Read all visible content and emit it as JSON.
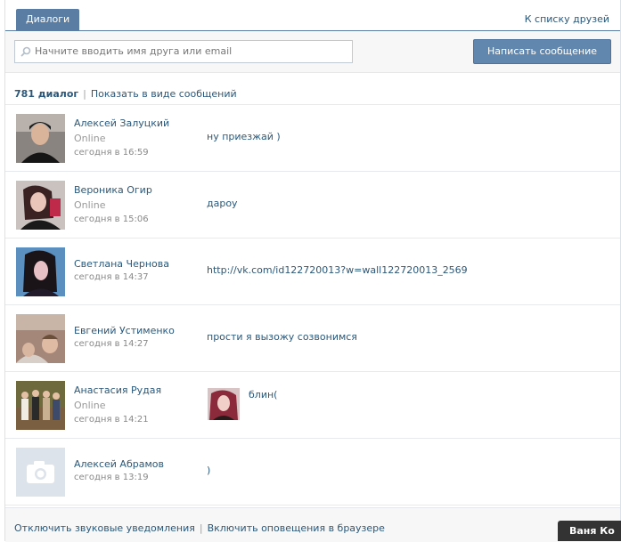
{
  "tabs": {
    "active": "Диалоги",
    "friends_link": "К списку друзей"
  },
  "search": {
    "placeholder": "Начните вводить имя друга или email"
  },
  "write_button": "Написать сообщение",
  "summary": {
    "count": "781 диалог",
    "show_as_messages": "Показать в виде сообщений"
  },
  "dialogs": [
    {
      "name": "Алексей Залуцкий",
      "status": "Online",
      "time": "сегодня в 16:59",
      "message": "ну приезжай )"
    },
    {
      "name": "Вероника Огир",
      "status": "Online",
      "time": "сегодня в 15:06",
      "message": "дароу"
    },
    {
      "name": "Светлана Чернова",
      "status": "",
      "time": "сегодня в 14:37",
      "message": "http://vk.com/id122720013?w=wall122720013_2569"
    },
    {
      "name": "Евгений Устименко",
      "status": "",
      "time": "сегодня в 14:27",
      "message": "прости я вызожу созвонимся"
    },
    {
      "name": "Анастасия Рудая",
      "status": "Online",
      "time": "сегодня в 14:21",
      "message": "блин("
    },
    {
      "name": "Алексей Абрамов",
      "status": "",
      "time": "сегодня в 13:19",
      "message": ")"
    }
  ],
  "footer": {
    "disable_sounds": "Отключить звуковые уведомления",
    "enable_browser": "Включить оповещения в браузере"
  },
  "chat_bar": "Ваня Ко",
  "colors": {
    "accent": "#597da3",
    "link": "#2b587a",
    "button": "#6287ae"
  }
}
